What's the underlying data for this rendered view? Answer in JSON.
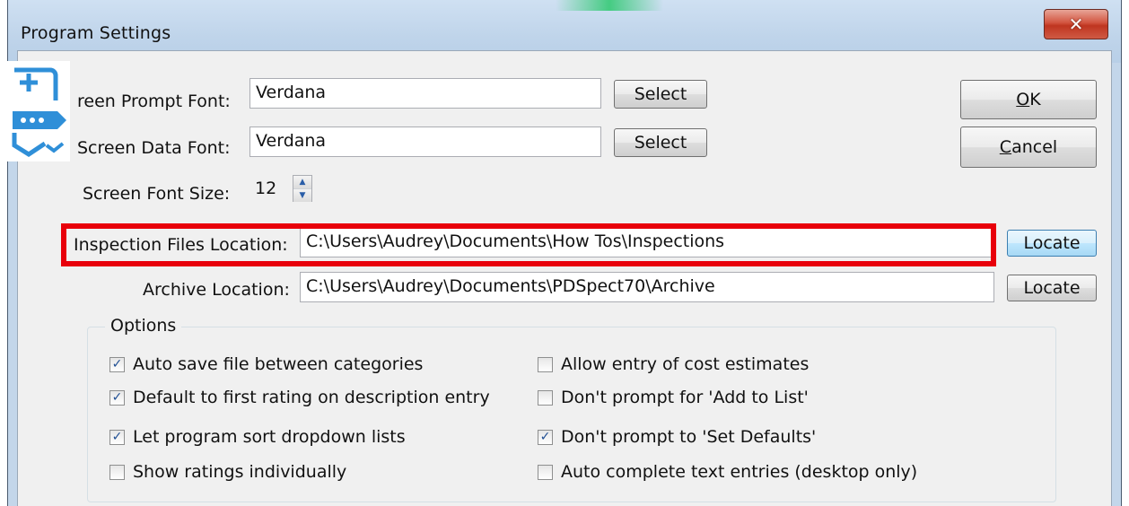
{
  "window": {
    "title": "Program Settings",
    "close_glyph": "✕"
  },
  "fields": {
    "prompt_font": {
      "label": "reen Prompt Font:",
      "value": "Verdana",
      "button": "Select"
    },
    "data_font": {
      "label": "Screen Data Font:",
      "value": "Verdana",
      "button": "Select"
    },
    "font_size": {
      "label": "Screen Font Size:",
      "value": "12"
    },
    "inspection_location": {
      "label": "Inspection Files Location:",
      "value": "C:\\Users\\Audrey\\Documents\\How Tos\\Inspections",
      "button": "Locate"
    },
    "archive_location": {
      "label": "Archive Location:",
      "value": "C:\\Users\\Audrey\\Documents\\PDSpect70\\Archive",
      "button": "Locate"
    }
  },
  "buttons": {
    "ok_mnemonic": "O",
    "ok_rest": "K",
    "cancel_mnemonic": "C",
    "cancel_rest": "ancel"
  },
  "options": {
    "group_title": "Options",
    "left": [
      {
        "label": "Auto save file between categories",
        "checked": true
      },
      {
        "label": "Default to first rating on description entry",
        "checked": true
      },
      {
        "label": "Let program sort dropdown lists",
        "checked": true
      },
      {
        "label": "Show ratings individually",
        "checked": false
      }
    ],
    "right": [
      {
        "label": "Allow entry of cost estimates",
        "checked": false
      },
      {
        "label": "Don't prompt for 'Add to List'",
        "checked": false
      },
      {
        "label": "Don't prompt to 'Set Defaults'",
        "checked": true
      },
      {
        "label": "Auto complete text entries (desktop only)",
        "checked": false
      }
    ]
  },
  "colors": {
    "highlight": "#e8000b",
    "icon": "#2f8fd8",
    "check": "#1f4e93"
  },
  "icons": {
    "app": "app-logo-icon",
    "close": "close-icon",
    "spin_up": "spin-up-icon",
    "spin_down": "spin-down-icon",
    "check": "checkmark-icon"
  }
}
